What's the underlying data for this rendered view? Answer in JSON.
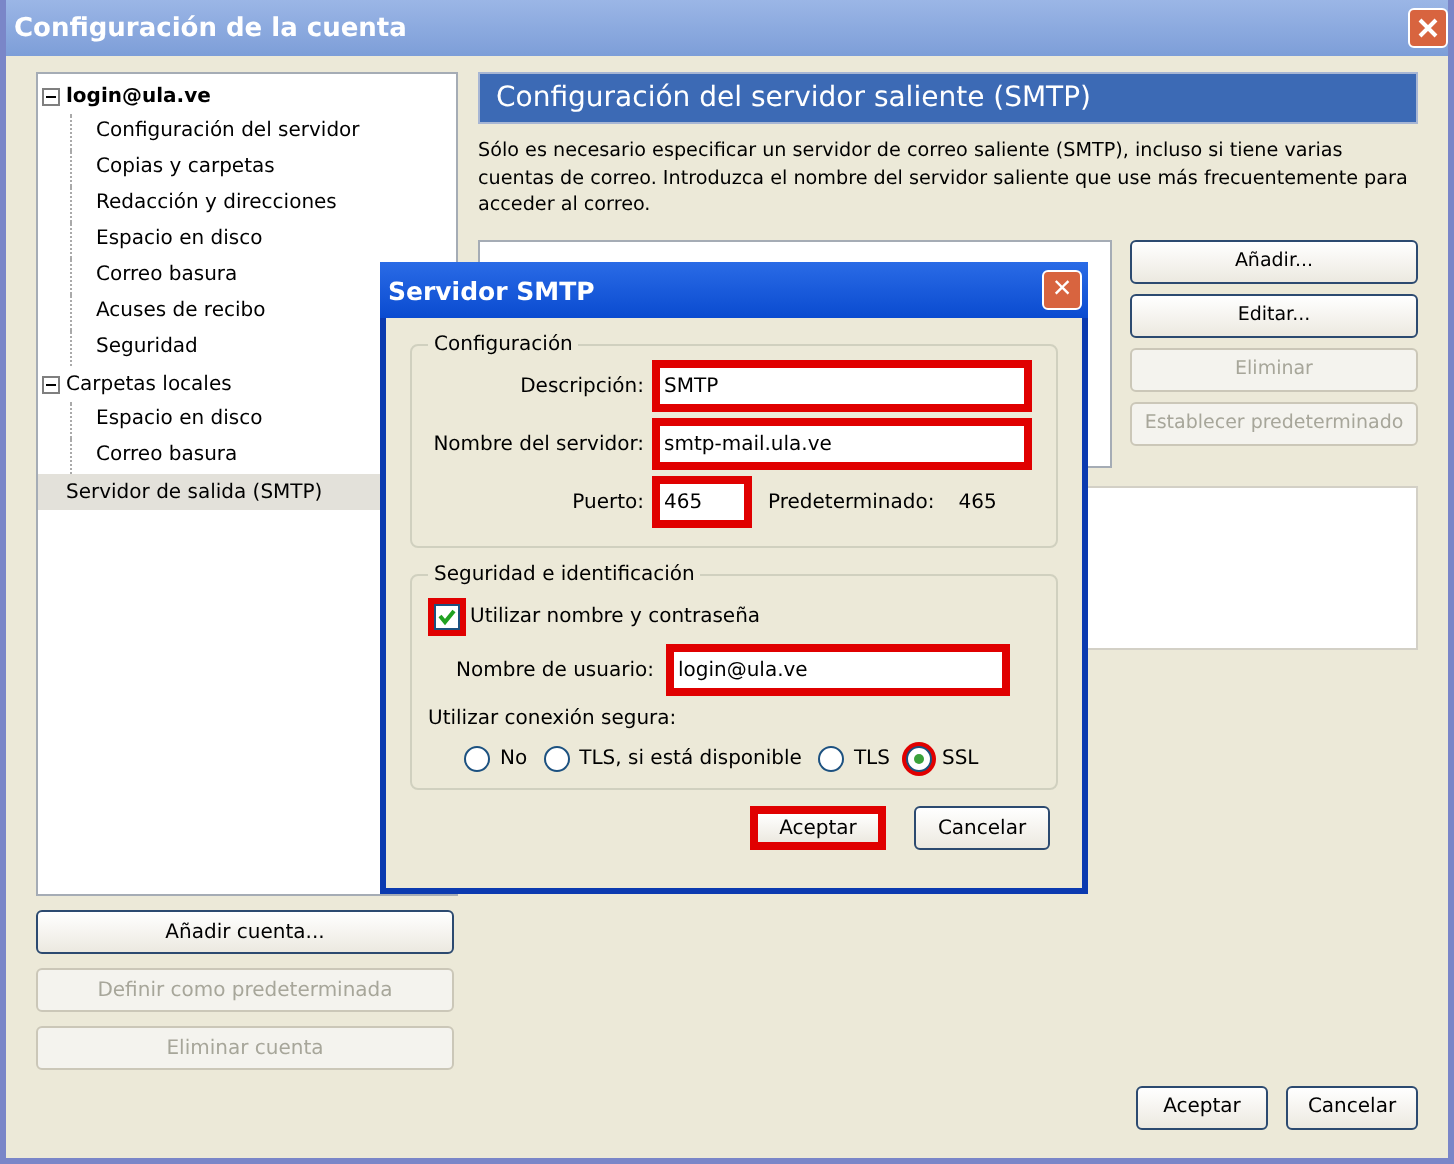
{
  "window": {
    "title": "Configuración de la cuenta"
  },
  "tree": [
    {
      "label": "login@ula.ve",
      "bold": true,
      "expanded": true,
      "selected": false,
      "children": [
        {
          "label": "Configuración del servidor",
          "selected": false
        },
        {
          "label": "Copias y carpetas",
          "selected": false
        },
        {
          "label": "Redacción y direcciones",
          "selected": false
        },
        {
          "label": "Espacio en disco",
          "selected": false
        },
        {
          "label": "Correo basura",
          "selected": false
        },
        {
          "label": "Acuses de recibo",
          "selected": false
        },
        {
          "label": "Seguridad",
          "selected": false
        }
      ]
    },
    {
      "label": "Carpetas locales",
      "bold": false,
      "expanded": true,
      "selected": false,
      "children": [
        {
          "label": "Espacio en disco",
          "selected": false
        },
        {
          "label": "Correo basura",
          "selected": false
        }
      ]
    },
    {
      "label": "Servidor de salida (SMTP)",
      "bold": false,
      "selected": true
    }
  ],
  "left_buttons": [
    {
      "label": "Añadir cuenta...",
      "disabled": false
    },
    {
      "label": "Definir como predeterminada",
      "disabled": true
    },
    {
      "label": "Eliminar cuenta",
      "disabled": true
    }
  ],
  "panel": {
    "heading": "Configuración del servidor saliente (SMTP)",
    "description": "Sólo es necesario especificar un servidor de correo saliente (SMTP), incluso si tiene varias cuentas de correo. Introduzca el nombre del servidor saliente que use más frecuentemente para acceder al correo.",
    "buttons": [
      {
        "label": "Añadir...",
        "disabled": false
      },
      {
        "label": "Editar...",
        "disabled": false
      },
      {
        "label": "Eliminar",
        "disabled": true
      },
      {
        "label": "Establecer predeterminado",
        "disabled": true
      }
    ]
  },
  "footer_buttons": [
    "Aceptar",
    "Cancelar"
  ],
  "dialog": {
    "title": "Servidor SMTP",
    "close": "×",
    "config": {
      "legend": "Configuración",
      "fields": [
        {
          "label": "Descripción:",
          "value": "SMTP",
          "highlighted": true
        },
        {
          "label": "Nombre del servidor:",
          "value": "smtp-mail.ula.ve",
          "highlighted": true
        }
      ],
      "port": {
        "label": "Puerto:",
        "value": "465",
        "highlighted": true
      },
      "default_label": "Predeterminado:",
      "default_value": "465"
    },
    "security": {
      "legend": "Seguridad e identificación",
      "checkbox": {
        "label": "Utilizar nombre y contraseña",
        "checked": true,
        "highlighted": true
      },
      "username": {
        "label": "Nombre de usuario:",
        "value": "login@ula.ve",
        "highlighted": true
      },
      "secure_label": "Utilizar conexión segura:",
      "options": [
        {
          "label": "No",
          "selected": false,
          "highlighted": false
        },
        {
          "label": "TLS, si está disponible",
          "selected": false,
          "highlighted": false
        },
        {
          "label": "TLS",
          "selected": false,
          "highlighted": false
        },
        {
          "label": "SSL",
          "selected": true,
          "highlighted": true
        }
      ]
    },
    "buttons": [
      {
        "label": "Aceptar",
        "highlighted": true
      },
      {
        "label": "Cancelar",
        "highlighted": false
      }
    ]
  }
}
